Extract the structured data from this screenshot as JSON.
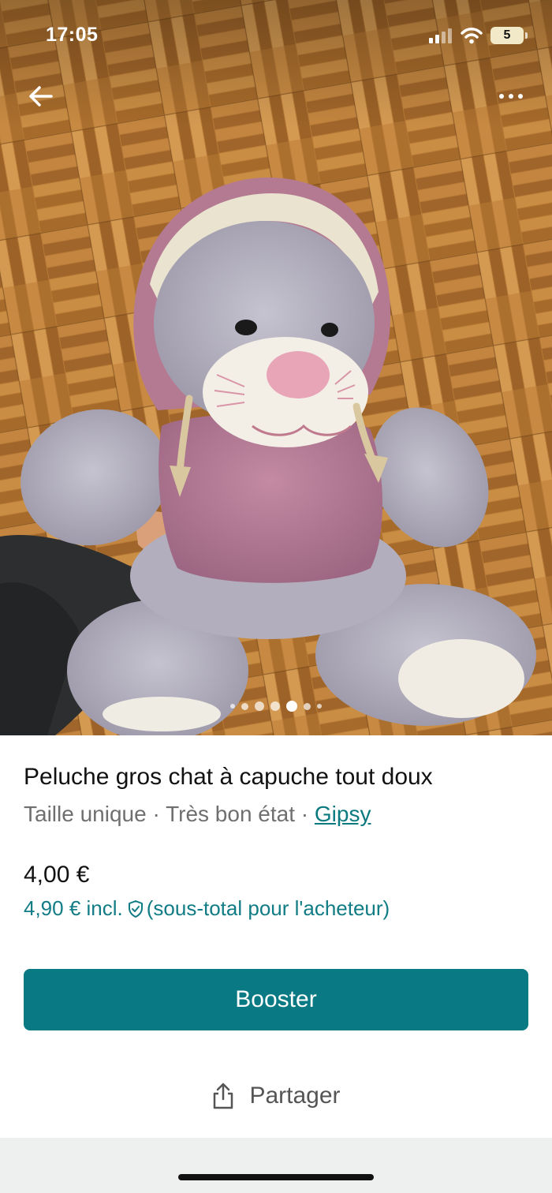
{
  "status_bar": {
    "time": "17:05",
    "battery": "5"
  },
  "photo": {
    "subject": "plush-cat-in-pink-hood",
    "pager_dots": 7,
    "active_index": 4
  },
  "listing": {
    "title": "Peluche gros chat à capuche tout doux",
    "size": "Taille unique",
    "separator": " · ",
    "condition": "Très bon état",
    "brand": "Gipsy",
    "price": "4,00 €",
    "price_incl": "4,90 € incl.",
    "price_incl_note": "(sous-total pour l'acheteur)"
  },
  "actions": {
    "booster_label": "Booster",
    "share_label": "Partager"
  },
  "colors": {
    "accent": "#097a84",
    "link": "#0b7a80",
    "meta_text": "#6f6f6f"
  },
  "icons": [
    "back-arrow-icon",
    "more-icon",
    "shield-icon",
    "share-icon",
    "wifi-icon",
    "signal-icon",
    "battery-icon"
  ]
}
